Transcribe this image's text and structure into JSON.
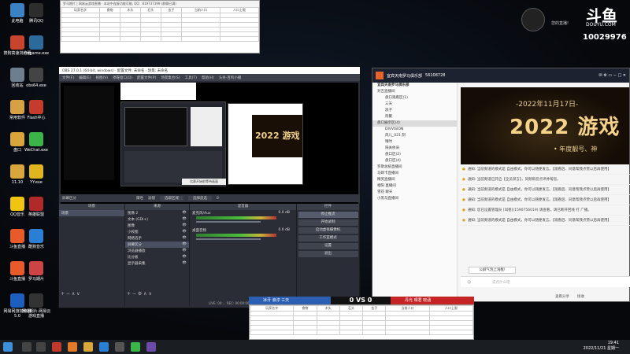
{
  "desktop": {
    "icons": [
      {
        "label": "此电脑",
        "color": "#3b82c4"
      },
      {
        "label": "腾讯QQ",
        "color": "#2d2d2d"
      },
      {
        "label": "搜狗高速浏览器",
        "color": "#c9442c"
      },
      {
        "label": "cmgame.exe",
        "color": "#2c6a9c"
      },
      {
        "label": "回收站",
        "color": "#6d7f8f"
      },
      {
        "label": "obs64.exe",
        "color": "#444"
      },
      {
        "label": "常用软件",
        "color": "#d6a043"
      },
      {
        "label": "Flash中心",
        "color": "#c53c2c"
      },
      {
        "label": "盘口",
        "color": "#d9a63b"
      },
      {
        "label": "WeChat.exe",
        "color": "#3bb54a"
      },
      {
        "label": "11.10",
        "color": "#d9a63b"
      },
      {
        "label": "YY.exe",
        "color": "#e0b51e"
      },
      {
        "label": "QQ音乐",
        "color": "#f1c40f"
      },
      {
        "label": "英雄联盟",
        "color": "#b02a2a"
      },
      {
        "label": "斗鱼直播",
        "color": "#e85a2a"
      },
      {
        "label": "酷狗音乐",
        "color": "#2a7fd4"
      },
      {
        "label": "斗鱼直播",
        "color": "#e85a2a"
      },
      {
        "label": "罗马期片",
        "color": "#c44"
      },
      {
        "label": "网易网游加速器5.0",
        "color": "#1d5fbf"
      },
      {
        "label": "罗马期片-网易云游戏直播",
        "color": "#333"
      }
    ]
  },
  "sheet_top": {
    "title": "罗马期片 | 网易云游戏直播 · 本站中连接功能可能, QQ：819737399 (群聊已满)",
    "headers": [
      "玩家名字",
      "食物",
      "木头",
      "石头",
      "金子",
      "当前人口",
      "人口上限"
    ]
  },
  "sheet_bottom": {
    "headers": [
      "玩家名字",
      "食物",
      "木头",
      "石头",
      "金子",
      "当前人口",
      "人口上限"
    ]
  },
  "obs": {
    "title": "OBS 27.0.1 (64-bit, windows) · 配置文件: 未命名 · 场景: 未命名",
    "menu": [
      "文件(F)",
      "编辑(E)",
      "视图(V)",
      "停靠窗口(D)",
      "配置文件(P)",
      "场景集合(S)",
      "工具(T)",
      "帮助(H)",
      "头条·百鸣小播"
    ],
    "preview_badge": "2022 游戏",
    "source_bar": {
      "label": "屏幕区分",
      "items": [
        "属性",
        "滤镜",
        "选取区域",
        "选择反选"
      ],
      "value": "0"
    },
    "scenes_header": "场景",
    "scenes": [
      "场景"
    ],
    "sources_header": "来源",
    "sources": [
      "图像 2",
      "文本 (GDI+)",
      "图像",
      "小校图",
      "网络选手",
      "屏幕区分",
      "浏览器播放",
      "比分板",
      "显示器采集"
    ],
    "mixer_header": "混音器",
    "mixer": [
      {
        "name": "麦克风/Aux",
        "db": "0.0 dB"
      },
      {
        "name": "桌面音频",
        "db": "0.0 dB"
      }
    ],
    "controls_header": "控件",
    "controls": [
      "停止推流",
      "开始录制",
      "启动虚拟摄像机",
      "工作室模式",
      "设置",
      "退出"
    ],
    "status": "LIVE: 00:...  REC: 00:00:00  CPU: 21.9%, 30.00 fps",
    "preview_popup": "比赛开始前等待画面"
  },
  "chat": {
    "room": "宜宾天南罗马俱乐部",
    "room_id": "56108728",
    "channels_title": "宜宾天南罗马俱乐部",
    "channels": [
      {
        "name": "宜宾天南罗马俱乐部",
        "type": "hdr"
      },
      {
        "name": "对吉直播间",
        "type": "group"
      },
      {
        "name": "盘口观看区(1)",
        "type": "sub"
      },
      {
        "name": "三天",
        "type": "user"
      },
      {
        "name": "浪子",
        "type": "user"
      },
      {
        "name": "阿聚",
        "type": "user"
      },
      {
        "name": "盘口展示区(4)",
        "type": "hl"
      },
      {
        "name": "DIVVISION",
        "type": "user"
      },
      {
        "name": "风儿_021.刻",
        "type": "user"
      },
      {
        "name": "晴时",
        "type": "user"
      },
      {
        "name": "阳关依旧",
        "type": "user"
      },
      {
        "name": "盘口区(2)",
        "type": "sub"
      },
      {
        "name": "盘口区(4)",
        "type": "sub"
      },
      {
        "name": "罗斯总统直播间",
        "type": "group"
      },
      {
        "name": "马蹄卡直播间",
        "type": "group"
      },
      {
        "name": "精英直播间",
        "type": "group"
      },
      {
        "name": "相阳 直播间",
        "type": "group"
      },
      {
        "name": "雪花 聊天",
        "type": "group"
      },
      {
        "name": "小黑马直播间",
        "type": "group"
      }
    ],
    "stream": {
      "date": "-2022年11月17日-",
      "title": "2022 游戏",
      "subtitle": "• 年度靓号、神"
    },
    "messages": [
      "通知: 当前频道的模式是 自由模式，你可以随便发言。【观看后、同意帮我点赞以后再使用】",
      "通知: 当前频道已开启【全员禁言】，同频帮您点评并帮您。",
      "通知: 当前频道的模式是 自由模式，你可以随便发言。【观看后、同意帮我点赞以后再使用】",
      "通知: 当前频道的模式是 自由模式，你可以随便发言。【观看后、同意帮我点赞以后再使用】",
      "通知: 您已设置管理员 [叫爸](1590756019) 请查看，请已断开回线 打 广播。",
      "通知: 当前频道的模式是 自由模式，你可以随便发言。【观看后、同意帮我点赞以后再使用】"
    ],
    "input_hint": "公屏气泡上浅框!",
    "input_placeholder": "说点什么吧",
    "bottom": [
      "查看分享",
      "接收"
    ]
  },
  "douyu": {
    "logo": "斗鱼",
    "domain": "DOUYU.COM",
    "room_number": "10029976",
    "caption": "您的直播!"
  },
  "score": {
    "left_team": "冰牙 浪淳 三天",
    "vs": "0 VS 0",
    "right_team": "丹光 晴君 晓涵"
  },
  "taskbar": {
    "time": "19:41",
    "date": "2022/11/21 星期一"
  }
}
